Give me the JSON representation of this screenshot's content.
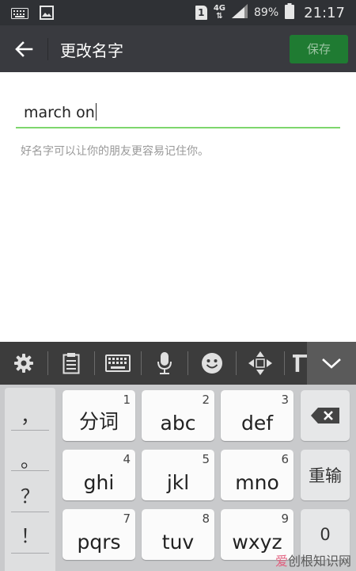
{
  "status_bar": {
    "battery": "89%",
    "time": "21:17",
    "network": "4G",
    "sim_slot": "1",
    "icons": [
      "keyboard-icon",
      "image-icon",
      "sim-icon",
      "signal-icon",
      "battery-icon"
    ]
  },
  "header": {
    "back_icon": "arrow-left-icon",
    "title": "更改名字",
    "save_label": "保存",
    "colors": {
      "header_bg": "#393a3f",
      "save_bg": "#1f7b32",
      "save_text": "#9ac3a1"
    }
  },
  "form": {
    "name_value": "march on",
    "hint": "好名字可以让你的朋友更容易记住你。",
    "underline_color": "#7ed66d"
  },
  "keyboard": {
    "toolbar_icons": [
      "gear-icon",
      "clipboard-icon",
      "keyboard-icon",
      "microphone-icon",
      "emoji-icon",
      "cursor-move-icon",
      "text-icon",
      "chevron-down-icon"
    ],
    "symbols": [
      "，",
      "。",
      "？",
      "！"
    ],
    "keys": [
      {
        "label": "分词",
        "num": "1"
      },
      {
        "label": "abc",
        "num": "2"
      },
      {
        "label": "def",
        "num": "3"
      },
      {
        "label": "ghi",
        "num": "4"
      },
      {
        "label": "jkl",
        "num": "5"
      },
      {
        "label": "mno",
        "num": "6"
      },
      {
        "label": "pqrs",
        "num": "7"
      },
      {
        "label": "tuv",
        "num": "8"
      },
      {
        "label": "wxyz",
        "num": "9"
      }
    ],
    "delete_icon": "backspace-icon",
    "reenter_label": "重输",
    "zero_label": "0"
  },
  "watermark": {
    "part1": "爱",
    "part2": "创根知识网"
  }
}
